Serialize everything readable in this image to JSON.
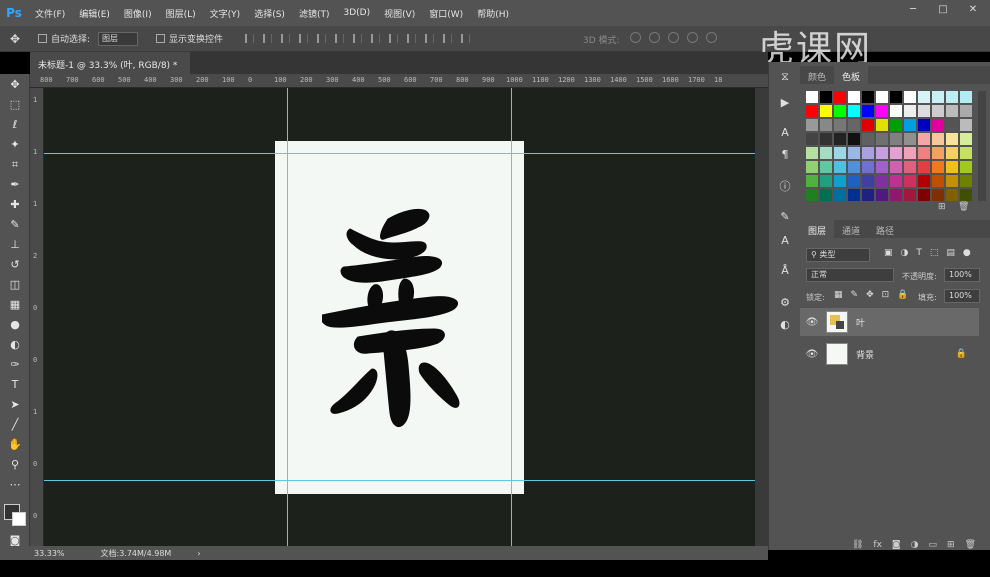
{
  "app": {
    "logo": "Ps"
  },
  "menu": [
    "文件(F)",
    "编辑(E)",
    "图像(I)",
    "图层(L)",
    "文字(Y)",
    "选择(S)",
    "滤镜(T)",
    "3D(D)",
    "视图(V)",
    "窗口(W)",
    "帮助(H)"
  ],
  "options": {
    "auto_select_label": "自动选择:",
    "auto_select_value": "图层",
    "show_transform_label": "显示变换控件",
    "mode_3d_label": "3D 模式:"
  },
  "watermark": "虎课网",
  "document": {
    "tab_title": "未标题-1 @ 33.3% (叶, RGB/8) *"
  },
  "ruler": {
    "h_ticks": [
      "800",
      "700",
      "600",
      "500",
      "400",
      "300",
      "200",
      "100",
      "0",
      "100",
      "200",
      "300",
      "400",
      "500",
      "600",
      "700",
      "800",
      "900",
      "1000",
      "1100",
      "1200",
      "1300",
      "1400",
      "1500",
      "1600",
      "1700",
      "18"
    ],
    "v_ticks": [
      "1",
      "1",
      "1",
      "2",
      "0",
      "0",
      "1",
      "0",
      "0"
    ]
  },
  "status": {
    "zoom": "33.33%",
    "doc_info": "文档:3.74M/4.98M"
  },
  "panels": {
    "swatch_tabs": [
      "颜色",
      "色板"
    ],
    "layer_tabs": [
      "图层",
      "通道",
      "路径"
    ],
    "filter_kind": "类型",
    "blend_mode": "正常",
    "opacity_label": "不透明度:",
    "opacity_value": "100%",
    "lock_label": "锁定:",
    "fill_label": "填充:",
    "fill_value": "100%",
    "layers": [
      {
        "name": "叶",
        "locked": false,
        "selected": true
      },
      {
        "name": "背景",
        "locked": true,
        "selected": false
      }
    ]
  },
  "swatches": [
    "#ffffff",
    "#000000",
    "#ff0000",
    "#ffffff",
    "#000000",
    "#ffffff",
    "#000000",
    "#ffffff",
    "#d7f3f7",
    "#c8f0f5",
    "#bdeef4",
    "#b2ecf3",
    "#ff0000",
    "#ffff00",
    "#00ff00",
    "#00ffff",
    "#0000ff",
    "#ff00ff",
    "#ffffff",
    "#eeeeee",
    "#dddddd",
    "#cccccc",
    "#bbbbbb",
    "#aaaaaa",
    "#999999",
    "#888888",
    "#777777",
    "#666666",
    "#e00000",
    "#e0e000",
    "#00a000",
    "#00a0e0",
    "#0000c0",
    "#e000a0",
    "#555555",
    "#bbbbbb",
    "#444444",
    "#333333",
    "#222222",
    "#111111",
    "#606060",
    "#707070",
    "#808080",
    "#909090",
    "#f4a6a6",
    "#f6c79a",
    "#f7e39a",
    "#d6eb9b",
    "#b5e0a0",
    "#a6dcc4",
    "#9ad8e5",
    "#9ab7e5",
    "#a8a0e0",
    "#c79ee0",
    "#e4a0d2",
    "#f0a0b8",
    "#f08080",
    "#f5a060",
    "#f5d060",
    "#c8e060",
    "#90d070",
    "#60c8a0",
    "#50c0e0",
    "#5090d8",
    "#7070d0",
    "#a060d0",
    "#d060b0",
    "#e06080",
    "#e04040",
    "#f07820",
    "#f0c020",
    "#a0c820",
    "#50b040",
    "#20a080",
    "#10a0d0",
    "#2060c0",
    "#4040a0",
    "#8030a0",
    "#c03090",
    "#d03060",
    "#b00000",
    "#c05000",
    "#c09000",
    "#708000",
    "#208020",
    "#007050",
    "#0070a0",
    "#003090",
    "#202080",
    "#501880",
    "#901870",
    "#a01840",
    "#800000",
    "#803000",
    "#806000",
    "#405000"
  ]
}
